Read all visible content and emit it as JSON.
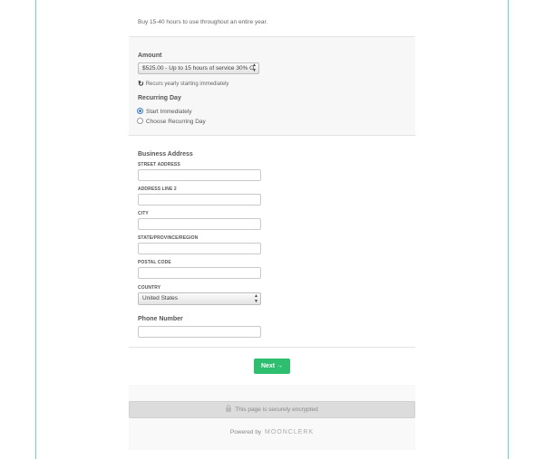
{
  "intro": {
    "text": "Buy 15-40 hours to use throughout an entire year."
  },
  "amount": {
    "label": "Amount",
    "selected": "$525.00 - Up to 15 hours of service 30% O",
    "recurs_text": "Recurs yearly starting immediately"
  },
  "recurring_day": {
    "label": "Recurring Day",
    "options": [
      {
        "label": "Start Immediately",
        "selected": true
      },
      {
        "label": "Choose Recurring Day",
        "selected": false
      }
    ]
  },
  "address": {
    "heading": "Business Address",
    "street_label": "STREET ADDRESS",
    "line2_label": "ADDRESS LINE 2",
    "city_label": "CITY",
    "state_label": "STATE/PROVINCE/REGION",
    "postal_label": "POSTAL CODE",
    "country_label": "COUNTRY",
    "country_value": "United States"
  },
  "phone": {
    "label": "Phone Number"
  },
  "next_button": {
    "label": "Next →"
  },
  "footer": {
    "encrypted_text": "This page is securely encrypted",
    "powered_by": "Powered by",
    "brand": "MOONCLERK"
  },
  "colors": {
    "accent_green": "#2dbf6f",
    "frame_line": "#5fe0b5",
    "radio_blue": "#3a7bd5"
  }
}
